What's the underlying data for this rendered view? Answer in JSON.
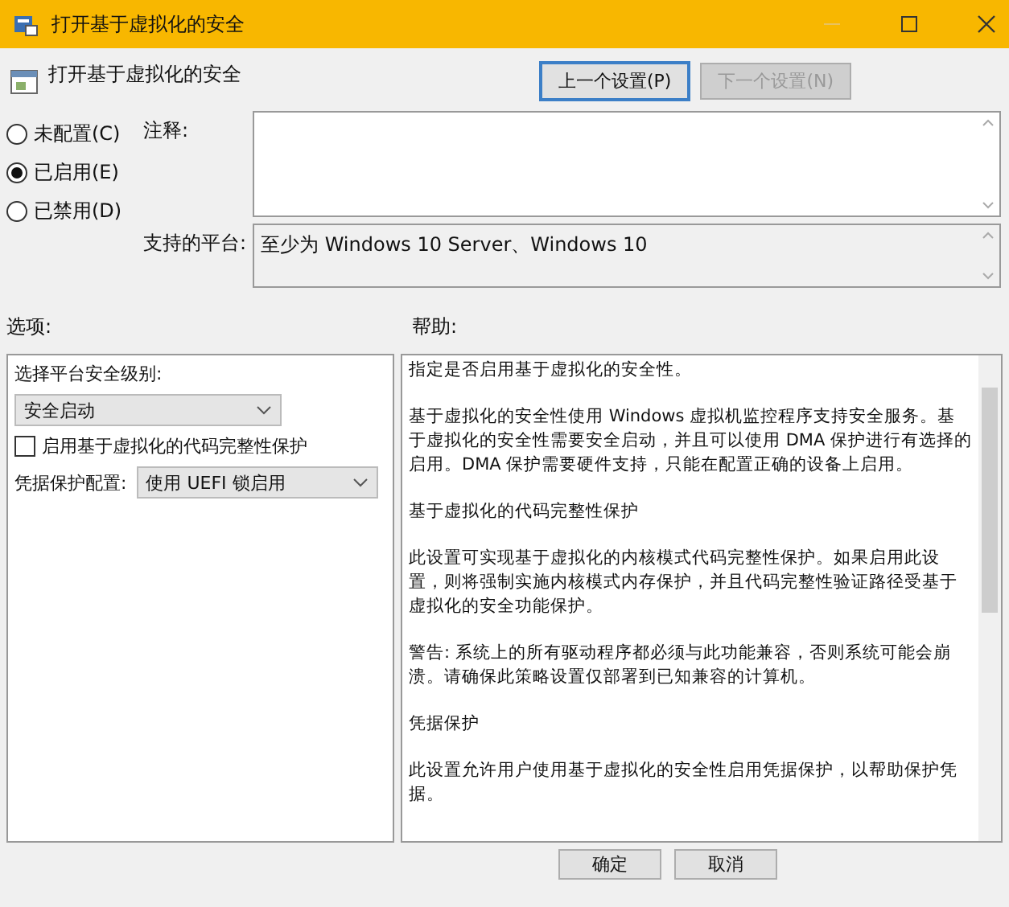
{
  "window": {
    "title": "打开基于虚拟化的安全"
  },
  "header": {
    "title": "打开基于虚拟化的安全",
    "buttons": [
      {
        "label": "上一个设置(P)",
        "disabled": false
      },
      {
        "label": "下一个设置(N)",
        "disabled": true
      }
    ]
  },
  "state_options": [
    {
      "label": "未配置(C)",
      "selected": false
    },
    {
      "label": "已启用(E)",
      "selected": true
    },
    {
      "label": "已禁用(D)",
      "selected": false
    }
  ],
  "comment": {
    "label": "注释:"
  },
  "platform": {
    "label": "支持的平台:",
    "value": "至少为 Windows 10 Server、Windows 10"
  },
  "options": {
    "label": "选项:",
    "level_label": "选择平台安全级别:",
    "level_value": "安全启动",
    "checkbox": {
      "label": "启用基于虚拟化的代码完整性保护",
      "checked": false
    },
    "credential_label": "凭据保护配置:",
    "credential_value": "使用 UEFI 锁启用"
  },
  "help": {
    "label": "帮助:",
    "paragraphs": [
      "指定是否启用基于虚拟化的安全性。",
      "基于虚拟化的安全性使用 Windows 虚拟机监控程序支持安全服务。基于虚拟化的安全性需要安全启动，并且可以使用 DMA 保护进行有选择的启用。DMA 保护需要硬件支持，只能在配置正确的设备上启用。",
      "基于虚拟化的代码完整性保护",
      "此设置可实现基于虚拟化的内核模式代码完整性保护。如果启用此设置，则将强制实施内核模式内存保护，并且代码完整性验证路径受基于虚拟化的安全功能保护。",
      "警告: 系统上的所有驱动程序都必须与此功能兼容，否则系统可能会崩溃。请确保此策略设置仅部署到已知兼容的计算机。",
      "凭据保护",
      "此设置允许用户使用基于虚拟化的安全性启用凭据保护，以帮助保护凭据。"
    ]
  },
  "footer": {
    "buttons": [
      "确定",
      "取消"
    ]
  }
}
